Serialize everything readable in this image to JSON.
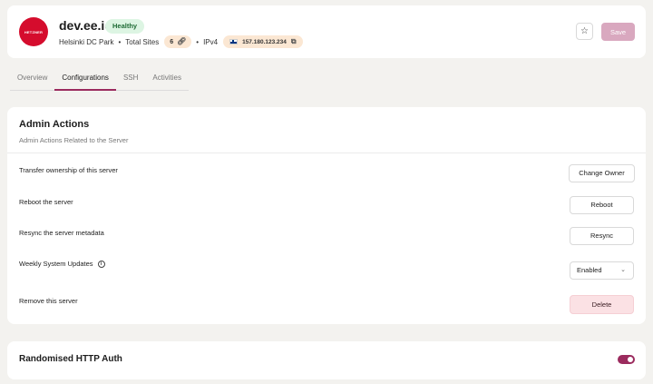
{
  "server": {
    "logo_text": "HETZNER",
    "name": "dev.ee.io",
    "status": "Healthy",
    "location": "Helsinki DC Park",
    "total_sites_label": "Total Sites",
    "total_sites": "6",
    "ip_type": "IPv4",
    "ip_address": "157.180.123.234"
  },
  "header": {
    "save_label": "Save",
    "star_icon": "☆"
  },
  "tabs": [
    {
      "label": "Overview",
      "active": false
    },
    {
      "label": "Configurations",
      "active": true
    },
    {
      "label": "SSH",
      "active": false
    },
    {
      "label": "Activities",
      "active": false
    }
  ],
  "admin": {
    "title": "Admin Actions",
    "subtitle": "Admin Actions Related to the Server",
    "rows": [
      {
        "label": "Transfer ownership of this server",
        "action": "Change Owner"
      },
      {
        "label": "Reboot the server",
        "action": "Reboot"
      },
      {
        "label": "Resync the server metadata",
        "action": "Resync"
      },
      {
        "label": "Weekly System Updates",
        "action": "Enabled"
      },
      {
        "label": "Remove this server",
        "action": "Delete"
      }
    ]
  },
  "auth": {
    "title": "Randomised HTTP Auth",
    "enabled": true
  },
  "colors": {
    "accent": "#9b2b5e",
    "healthy_bg": "#ddf5e3",
    "badge_bg": "#fbe7d3",
    "delete_bg": "#fbe1e4"
  }
}
